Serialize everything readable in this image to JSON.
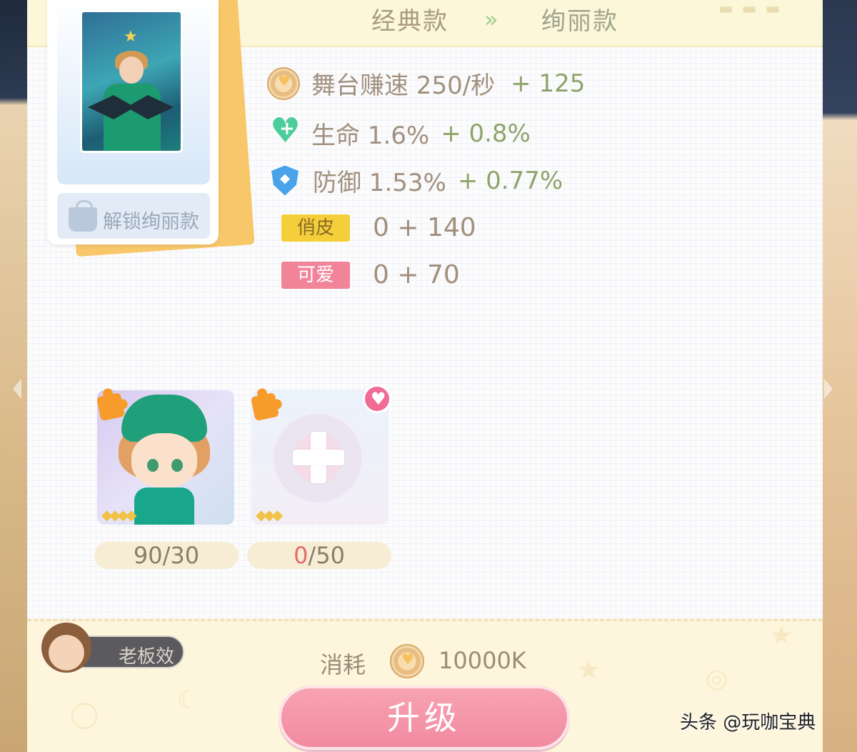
{
  "header": {
    "tab_classic": "经典款",
    "arrow": "››",
    "tab_gorgeous": "绚丽款"
  },
  "card": {
    "unlock_label": "解锁绚丽款"
  },
  "stats": [
    {
      "icon": "coin-icon",
      "text": "舞台赚速 250/秒",
      "plus": "+ 125"
    },
    {
      "icon": "heart-plus-icon",
      "text": "生命 1.6%",
      "plus": "+ 0.8%",
      "color": "#4ccd9c"
    },
    {
      "icon": "shield-icon",
      "text": "防御 1.53%",
      "plus": "+ 0.77%",
      "color": "#4aa3ea"
    }
  ],
  "traits": [
    {
      "tag": "俏皮",
      "value": "0 + 140",
      "color": "#f5cf3a"
    },
    {
      "tag": "可爱",
      "value": "0 + 70",
      "color": "#f2849a"
    }
  ],
  "slots": [
    {
      "count_current": "90",
      "count_rest": "/30",
      "stars": "◆◆◆◆"
    },
    {
      "count_current": "0",
      "count_rest": "/50",
      "stars": "◆◆◆"
    }
  ],
  "footer": {
    "avatar_label": "老板效",
    "cost_label": "消耗",
    "cost_value": "10000K",
    "upgrade_label": "升级"
  },
  "watermark": "头条 @玩咖宝典"
}
